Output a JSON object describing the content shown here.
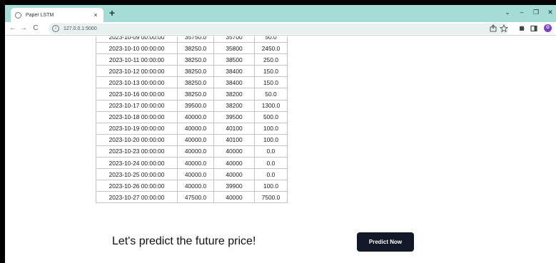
{
  "browser": {
    "tab_title": "Paper LSTM",
    "tab_close": "×",
    "new_tab": "+",
    "url": "127.0.0.1:5000",
    "avatar_letter": "O",
    "window_controls": {
      "dropdown": "⌄",
      "minimize": "–",
      "maximize": "❐",
      "close": "✕"
    },
    "toolbar_icons": [
      "share-icon",
      "star-icon",
      "extensions-icon",
      "sidebar-icon",
      "profile-avatar",
      "menu-icon"
    ]
  },
  "table": {
    "rows": [
      [
        "2023-10-09 00:00:00",
        "35750.0",
        "35700",
        "50.0"
      ],
      [
        "2023-10-10 00:00:00",
        "38250.0",
        "35800",
        "2450.0"
      ],
      [
        "2023-10-11 00:00:00",
        "38250.0",
        "38500",
        "250.0"
      ],
      [
        "2023-10-12 00:00:00",
        "38250.0",
        "38400",
        "150.0"
      ],
      [
        "2023-10-13 00:00:00",
        "38250.0",
        "38400",
        "150.0"
      ],
      [
        "2023-10-16 00:00:00",
        "38250.0",
        "38200",
        "50.0"
      ],
      [
        "2023-10-17 00:00:00",
        "39500.0",
        "38200",
        "1300.0"
      ],
      [
        "2023-10-18 00:00:00",
        "40000.0",
        "39500",
        "500.0"
      ],
      [
        "2023-10-19 00:00:00",
        "40000.0",
        "40100",
        "100.0"
      ],
      [
        "2023-10-20 00:00:00",
        "40000.0",
        "40100",
        "100.0"
      ],
      [
        "2023-10-23 00:00:00",
        "40000.0",
        "40000",
        "0.0"
      ],
      [
        "2023-10-24 00:00:00",
        "40000.0",
        "40000",
        "0.0"
      ],
      [
        "2023-10-25 00:00:00",
        "40000.0",
        "40000",
        "0.0"
      ],
      [
        "2023-10-26 00:00:00",
        "40000.0",
        "39900",
        "100.0"
      ],
      [
        "2023-10-27 00:00:00",
        "47500.0",
        "40000",
        "7500.0"
      ]
    ]
  },
  "predict": {
    "heading": "Let's predict the future price!",
    "button_label": "Predict Now"
  }
}
